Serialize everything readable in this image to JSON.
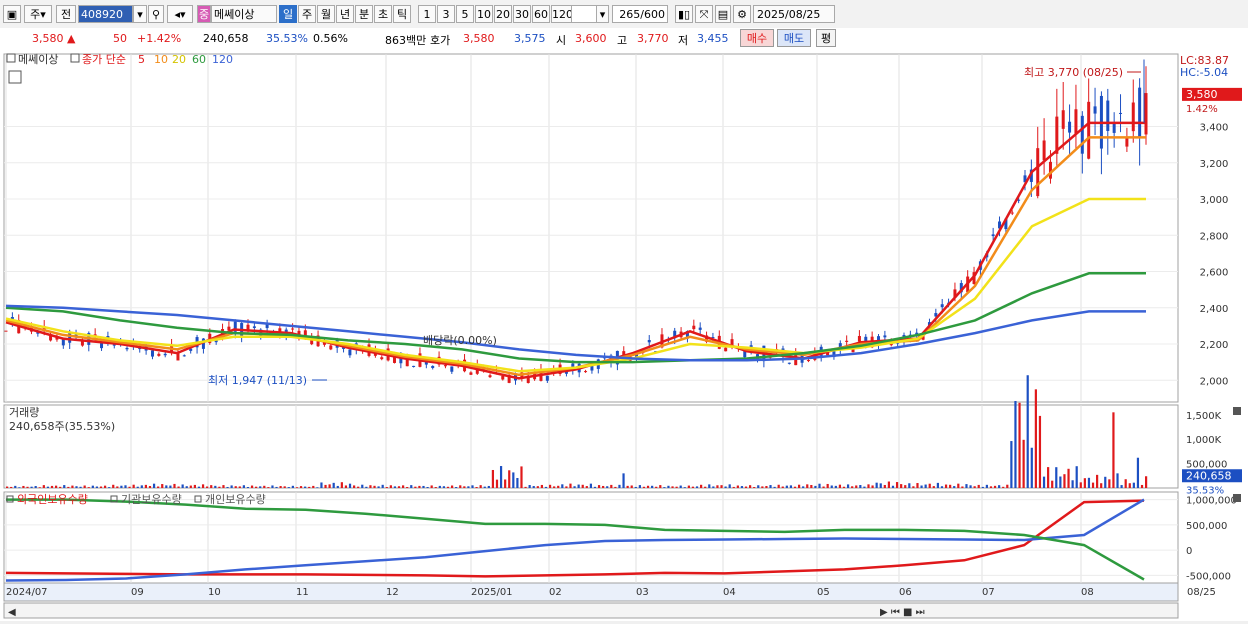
{
  "toolbar": {
    "market": "주",
    "prev_label": "전",
    "code": "408920",
    "badge": "중",
    "name": "메쎄이상",
    "periods": [
      "일",
      "주",
      "월",
      "년",
      "분",
      "초",
      "틱"
    ],
    "intervals": [
      "1",
      "3",
      "5",
      "10",
      "20",
      "30",
      "60",
      "120"
    ],
    "count": "265",
    "count_max": "/600",
    "date": "2025/08/25"
  },
  "quote": {
    "price": "3,580",
    "arrow": "▲",
    "change": "50",
    "pct": "+1.42%",
    "volume": "240,658",
    "vol_ratio": "35.53%",
    "turnover": "0.56%",
    "amount": "863백만",
    "hoga_label": "호가",
    "ask": "3,580",
    "bid": "3,575",
    "open_label": "시",
    "open": "3,600",
    "high_label": "고",
    "high": "3,770",
    "low_label": "저",
    "low": "3,455",
    "buy": "매수",
    "sell": "매도",
    "eval": "평"
  },
  "legend": {
    "name": "메쎄이상",
    "close_label": "종가 단순",
    "ma": [
      "5",
      "10",
      "20",
      "60",
      "120"
    ]
  },
  "annotations": {
    "high": "최고 3,770 (08/25)",
    "low": "최저 1,947 (11/13)",
    "dividend": "배당락(0.00%)",
    "lc": "LC:83.87",
    "hc": "HC:-5.04",
    "last_price": "3,580",
    "last_pct": "1.42%"
  },
  "volume_panel": {
    "title": "거래량",
    "value": "240,658주(35.53%)",
    "last": "240,658",
    "last_pct": "35.53%"
  },
  "holders_panel": {
    "labels": [
      "외국인보유수량",
      "기관보유수량",
      "개인보유수량"
    ]
  },
  "colors": {
    "up": "#e0191b",
    "down": "#1c4fc2",
    "ma5": "#e0191b",
    "ma10": "#f28c1a",
    "ma20": "#f2e21a",
    "ma60": "#2e9a3e",
    "ma120": "#3a62d6"
  },
  "chart_data": [
    {
      "type": "line",
      "name": "price-candles-with-moving-averages",
      "x_labels": [
        "2024/07",
        "09",
        "10",
        "11",
        "12",
        "2025/01",
        "02",
        "03",
        "04",
        "05",
        "06",
        "07",
        "08",
        "08/25"
      ],
      "y_ticks": [
        2000,
        2200,
        2400,
        2600,
        2800,
        3000,
        3200,
        3400
      ],
      "ylim": [
        1880,
        3800
      ],
      "series": [
        {
          "name": "5",
          "values": [
            2320,
            2230,
            2200,
            2150,
            2280,
            2260,
            2180,
            2120,
            2080,
            2010,
            2060,
            2150,
            2270,
            2160,
            2120,
            2210,
            2230,
            2580,
            3150,
            3420,
            3420
          ]
        },
        {
          "name": "10",
          "values": [
            2330,
            2250,
            2210,
            2170,
            2260,
            2250,
            2190,
            2130,
            2090,
            2030,
            2070,
            2140,
            2240,
            2170,
            2140,
            2200,
            2220,
            2520,
            3050,
            3340,
            3340
          ]
        },
        {
          "name": "20",
          "values": [
            2340,
            2270,
            2220,
            2190,
            2240,
            2240,
            2200,
            2140,
            2100,
            2050,
            2070,
            2120,
            2200,
            2180,
            2150,
            2180,
            2230,
            2450,
            2850,
            3000,
            3000
          ]
        },
        {
          "name": "60",
          "values": [
            2400,
            2380,
            2330,
            2290,
            2260,
            2250,
            2220,
            2200,
            2170,
            2120,
            2100,
            2100,
            2110,
            2120,
            2150,
            2190,
            2250,
            2330,
            2480,
            2590,
            2590
          ]
        },
        {
          "name": "120",
          "values": [
            2410,
            2400,
            2380,
            2360,
            2330,
            2300,
            2270,
            2240,
            2210,
            2170,
            2140,
            2120,
            2110,
            2110,
            2120,
            2150,
            2200,
            2260,
            2330,
            2380,
            2380
          ]
        }
      ],
      "high": {
        "value": 3770,
        "date": "08/25"
      },
      "low": {
        "value": 1947,
        "date": "11/13"
      }
    },
    {
      "type": "bar",
      "name": "volume",
      "y_ticks_labels": [
        "500,000",
        "1,000K",
        "1,500K"
      ],
      "ylim": [
        0,
        1700000
      ],
      "values": [
        30000,
        40000,
        35000,
        45000,
        60000,
        50000,
        40000,
        35000,
        30000,
        80000,
        45000,
        40000,
        35000,
        40000,
        300000,
        45000,
        60000,
        45000,
        40000,
        35000,
        50000,
        40000,
        45000,
        60000,
        50000,
        90000,
        70000,
        60000,
        45000,
        1550000,
        300000,
        180000,
        120000,
        240658
      ]
    },
    {
      "type": "line",
      "name": "holdings",
      "y_ticks_labels": [
        "1,000,000",
        "500,000",
        "0",
        "-500,000"
      ],
      "ylim": [
        -650000,
        1150000
      ],
      "series": [
        {
          "name": "외국인보유수량",
          "values": [
            -450000,
            -460000,
            -470000,
            -480000,
            -480000,
            -480000,
            -490000,
            -500000,
            -520000,
            -500000,
            -480000,
            -450000,
            -460000,
            -420000,
            -380000,
            -300000,
            -200000,
            100000,
            950000,
            980000
          ]
        },
        {
          "name": "기관보유수량",
          "values": [
            -600000,
            -590000,
            -560000,
            -480000,
            -380000,
            -300000,
            -220000,
            -140000,
            -20000,
            100000,
            180000,
            200000,
            210000,
            220000,
            230000,
            220000,
            210000,
            200000,
            300000,
            1000000
          ]
        },
        {
          "name": "개인보유수량",
          "values": [
            1000000,
            1000000,
            960000,
            900000,
            820000,
            800000,
            720000,
            620000,
            520000,
            520000,
            500000,
            400000,
            380000,
            360000,
            400000,
            400000,
            380000,
            300000,
            100000,
            -580000
          ]
        }
      ]
    }
  ]
}
